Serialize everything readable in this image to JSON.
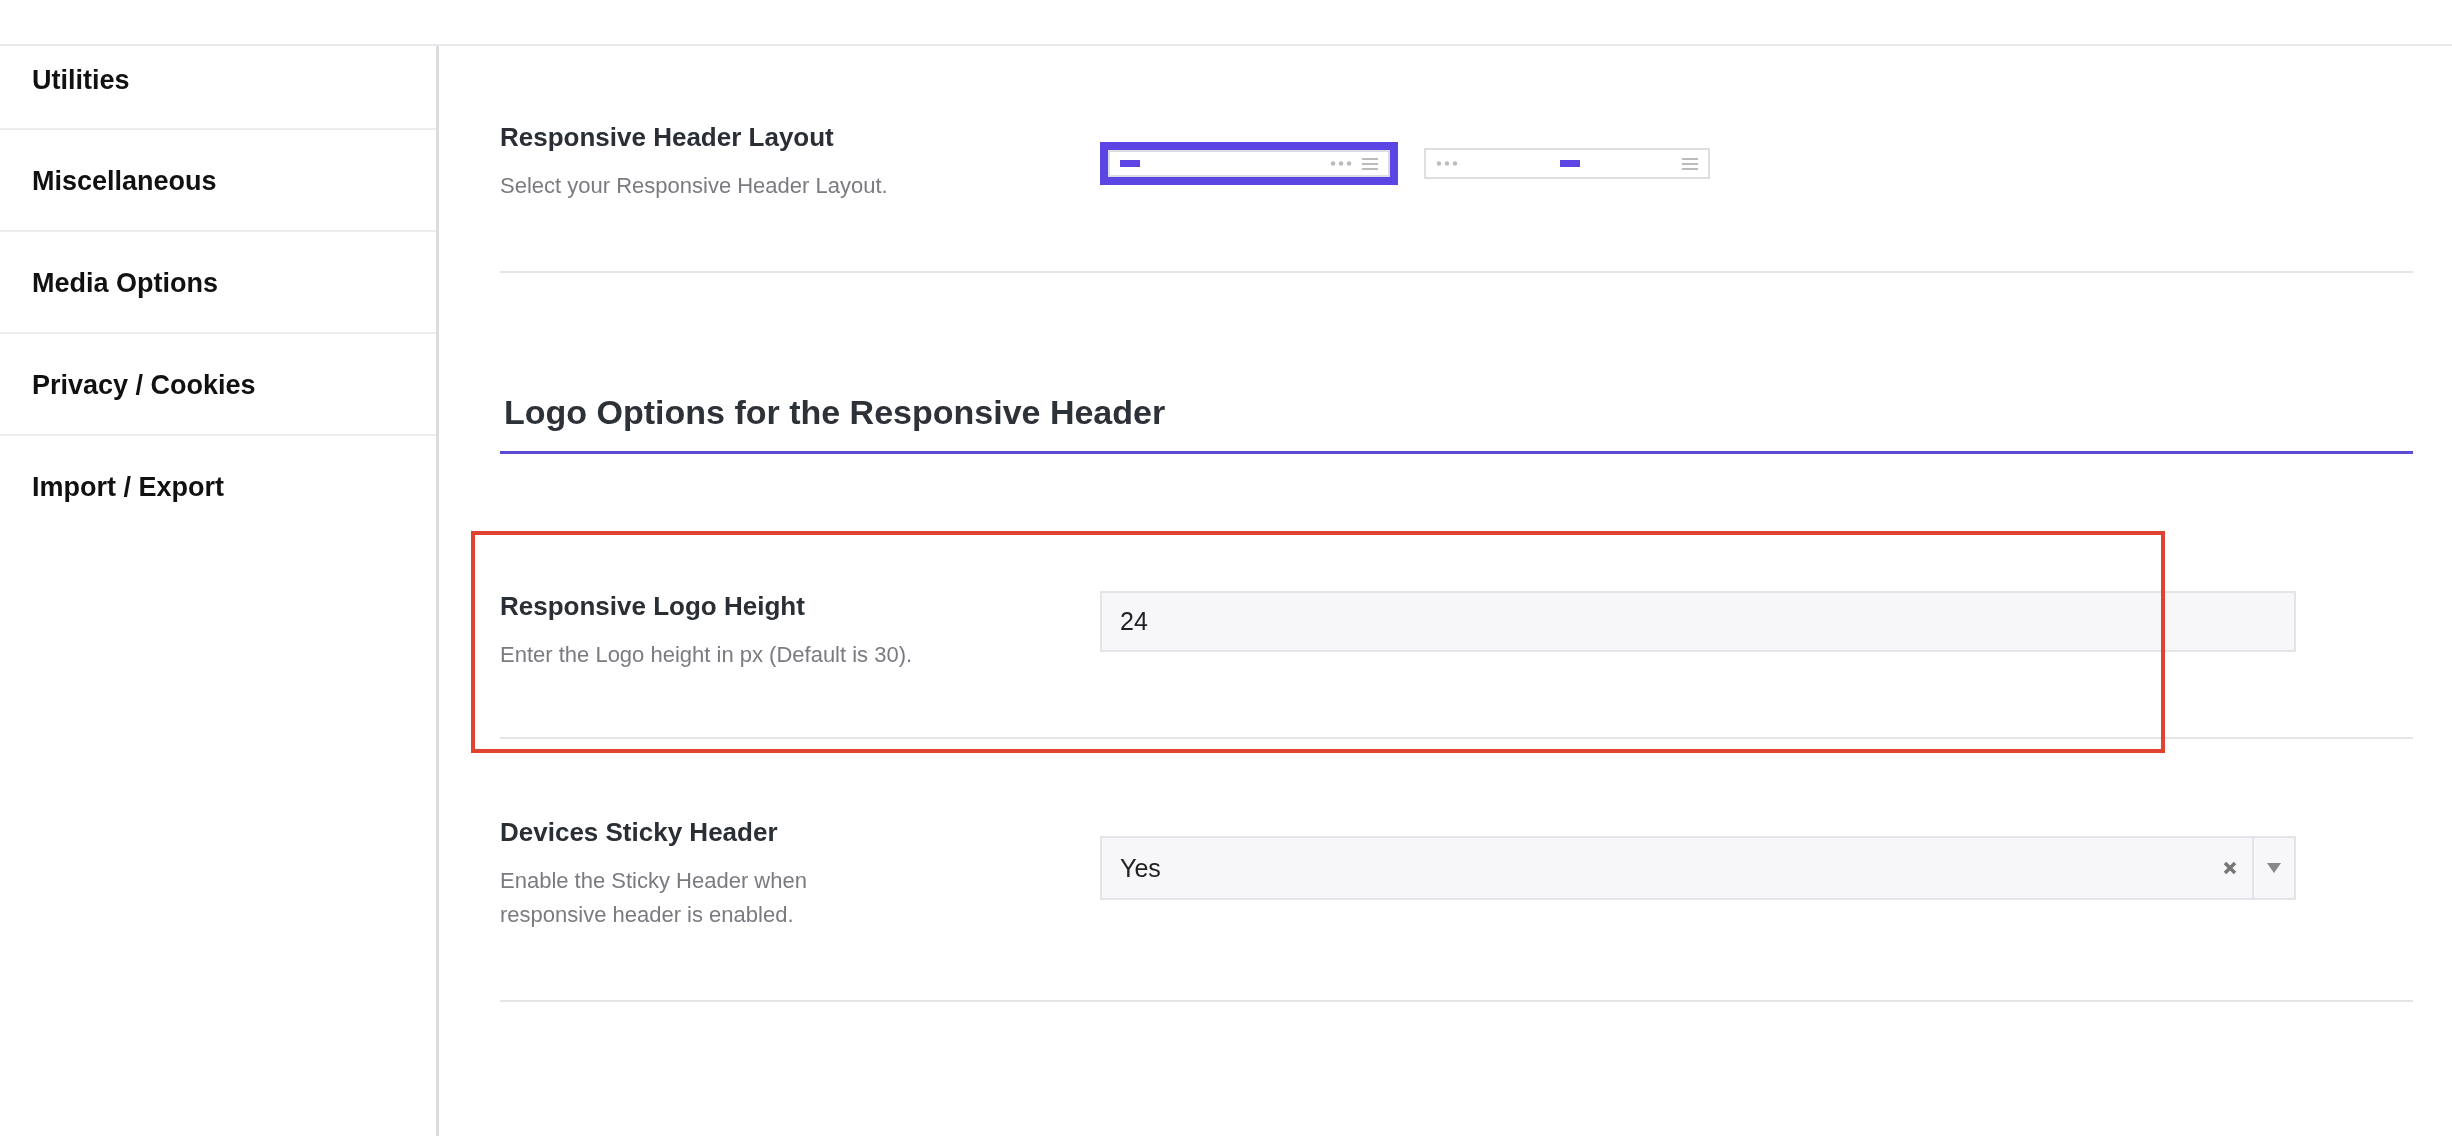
{
  "sidebar": {
    "items": [
      {
        "label": "Utilities"
      },
      {
        "label": "Miscellaneous"
      },
      {
        "label": "Media Options"
      },
      {
        "label": "Privacy / Cookies"
      },
      {
        "label": "Import / Export"
      }
    ]
  },
  "header_layout": {
    "label": "Responsive Header Layout",
    "description": "Select your Responsive Header Layout.",
    "options": [
      {
        "kind": "logo-left",
        "selected": true
      },
      {
        "kind": "logo-center",
        "selected": false
      }
    ]
  },
  "logo_section": {
    "heading": "Logo Options for the Responsive Header",
    "fields": [
      {
        "kind": "text",
        "label": "Responsive Logo Height",
        "description": "Enter the Logo height in px (Default is 30).",
        "value": "24",
        "highlighted": true
      },
      {
        "kind": "select",
        "label": "Devices Sticky Header",
        "description": "Enable the Sticky Header when responsive header is enabled.",
        "value": "Yes",
        "highlighted": false
      }
    ]
  }
}
